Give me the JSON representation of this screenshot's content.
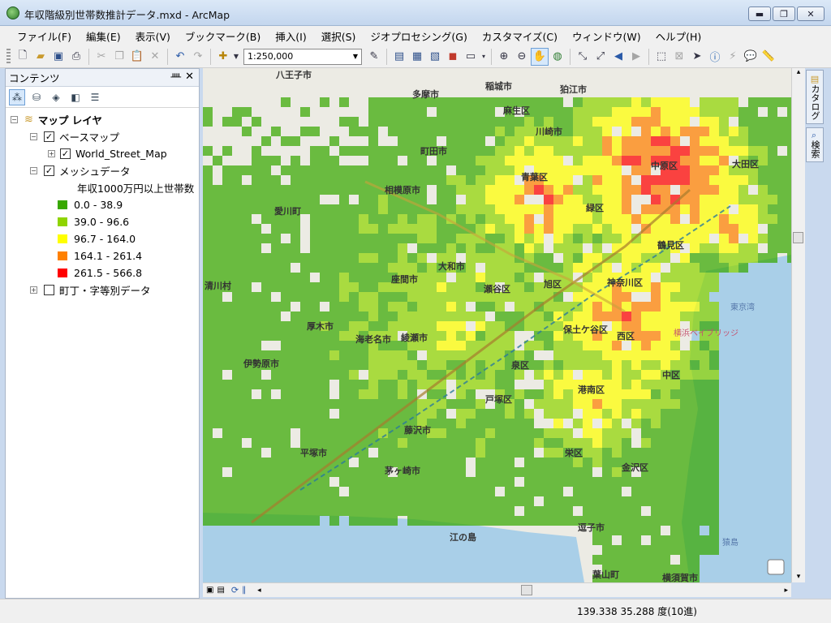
{
  "window": {
    "title": "年収階級別世帯数推計データ.mxd - ArcMap",
    "minimize": "▬",
    "maximize": "❐",
    "close": "✕"
  },
  "menu": [
    "ファイル(F)",
    "編集(E)",
    "表示(V)",
    "ブックマーク(B)",
    "挿入(I)",
    "選択(S)",
    "ジオプロセシング(G)",
    "カスタマイズ(C)",
    "ウィンドウ(W)",
    "ヘルプ(H)"
  ],
  "toolbar": {
    "scale": "1:250,000",
    "icons": [
      "new-icon",
      "open-icon",
      "save-icon",
      "print-icon",
      "cut-icon",
      "copy-icon",
      "paste-icon",
      "delete-icon",
      "undo-icon",
      "redo-icon",
      "add-data-icon",
      "editor-icon",
      "zoom-in-icon",
      "zoom-out-icon",
      "pan-icon",
      "full-extent-icon",
      "back-icon",
      "forward-icon",
      "select-icon",
      "identify-icon",
      "measure-icon"
    ]
  },
  "contents": {
    "title": "コンテンツ",
    "pin": "ᚉ",
    "close": "✕",
    "layers": {
      "root": "マップ レイヤ",
      "basemap_group": "ベースマップ",
      "basemap": "World_Street_Map",
      "mesh": "メッシュデータ",
      "mesh_field": "年収1000万円以上世帯数",
      "legend": [
        {
          "label": "0.0 - 38.9",
          "color": "#38a800"
        },
        {
          "label": "39.0 - 96.6",
          "color": "#8fd400"
        },
        {
          "label": "96.7 - 164.0",
          "color": "#ffff00"
        },
        {
          "label": "164.1 - 261.4",
          "color": "#ff8000"
        },
        {
          "label": "261.5 - 566.8",
          "color": "#ff0000"
        }
      ],
      "town": "町丁・字等別データ"
    }
  },
  "side_tabs": {
    "catalog": "カタログ",
    "search": "検索"
  },
  "status": {
    "coords": "139.338  35.288 度(10進)"
  },
  "map_labels": {
    "hachioji": "八王子市",
    "tama": "多摩市",
    "inagi": "稲城市",
    "komae": "狛江市",
    "asao": "麻生区",
    "machida": "町田市",
    "kawasaki": "川崎市",
    "aoba": "青葉区",
    "nakahara": "中原区",
    "ota": "大田区",
    "sagamihara": "相模原市",
    "midori": "緑区",
    "aikawa": "愛川町",
    "kiyokawa": "清川村",
    "yamato": "大和市",
    "zama": "座間市",
    "seya": "瀬谷区",
    "asahi": "旭区",
    "kanagawa": "神奈川区",
    "tsurumi": "鶴見区",
    "atsugi": "厚木市",
    "ebina": "海老名市",
    "ayase": "綾瀬市",
    "hodogaya": "保土ケ谷区",
    "nishi": "西区",
    "isehara": "伊勢原市",
    "izumi": "泉区",
    "naka": "中区",
    "totsuka": "戸塚区",
    "konan": "港南区",
    "fujisawa": "藤沢市",
    "hiratsuka": "平塚市",
    "chigasaki": "茅ヶ崎市",
    "sakae": "栄区",
    "kanazawa": "金沢区",
    "enoshima": "江の島",
    "zushi": "逗子市",
    "hayama": "葉山町",
    "yokosuka": "横須賀市",
    "bay": "横浜ベイブリッジ",
    "sarushima": "猿島",
    "tokyo_bay": "東京湾"
  }
}
